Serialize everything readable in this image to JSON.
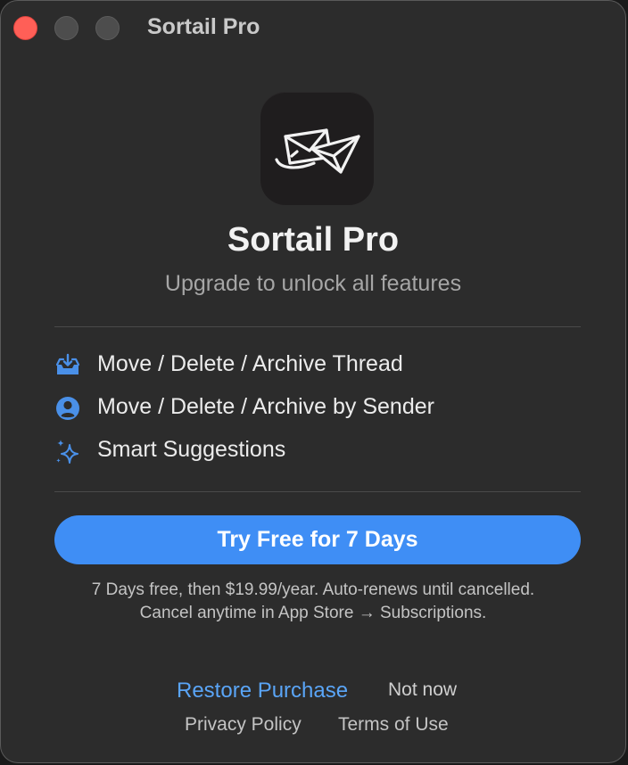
{
  "window": {
    "title": "Sortail Pro"
  },
  "header": {
    "app_icon": "envelope-icon",
    "app_name": "Sortail Pro",
    "subtitle": "Upgrade to unlock all features"
  },
  "features": [
    {
      "icon": "tray-download-icon",
      "label": "Move / Delete / Archive Thread"
    },
    {
      "icon": "person-circle-icon",
      "label": "Move / Delete / Archive by Sender"
    },
    {
      "icon": "sparkles-icon",
      "label": "Smart Suggestions"
    }
  ],
  "cta": {
    "label": "Try Free for 7 Days"
  },
  "terms": {
    "line1": "7 Days free, then $19.99/year. Auto-renews until cancelled.",
    "line2": "Cancel anytime in App Store → Subscriptions."
  },
  "footer": {
    "restore_label": "Restore Purchase",
    "not_now_label": "Not now",
    "privacy_label": "Privacy Policy",
    "terms_label": "Terms of Use"
  },
  "colors": {
    "accent": "#3f8ef5",
    "link": "#5aa5f7",
    "icon": "#4a90e8",
    "window_bg": "#2c2c2c",
    "close_button": "#ff5f57"
  }
}
